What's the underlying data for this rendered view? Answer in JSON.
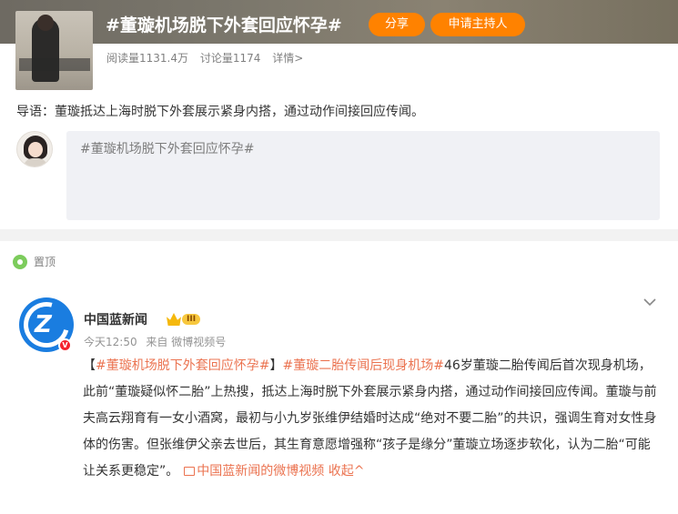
{
  "topic": {
    "title": "#董璇机场脱下外套回应怀孕#",
    "share_label": "分享",
    "host_label": "申请主持人",
    "read_count": "阅读量1131.4万",
    "discuss_count": "讨论量1174",
    "detail_label": "详情>",
    "intro": "导语：董璇抵达上海时脱下外套展示紧身内搭，通过动作间接回应传闻。"
  },
  "composer": {
    "placeholder": "#董璇机场脱下外套回应怀孕#"
  },
  "feed": {
    "pinned_label": "置顶",
    "post": {
      "author": "中国蓝新闻",
      "level": "III",
      "time": "今天12:50",
      "source": "来自 微博视频号",
      "text_prefix": "【",
      "tag1": "#董璇机场脱下外套回应怀孕#",
      "text_mid": "】",
      "tag2": "#董璇二胎传闻后现身机场#",
      "body": "46岁董璇二胎传闻后首次现身机场，此前“董璇疑似怀二胎”上热搜，抵达上海时脱下外套展示紧身内搭，通过动作间接回应传闻。董璇与前夫高云翔育有一女小酒窝，最初与小九岁张维伊结婚时达成“绝对不要二胎”的共识，强调生育对女性身体的伤害。但张维伊父亲去世后，其生育意愿增强称“孩子是缘分”董璇立场逐步软化，认为二胎“可能让关系更稳定”。",
      "video_link": "中国蓝新闻的微博视频",
      "collapse_label": "收起^"
    }
  },
  "colors": {
    "accent": "#ff8200",
    "link": "#eb7350",
    "banner": "#7b776c"
  }
}
